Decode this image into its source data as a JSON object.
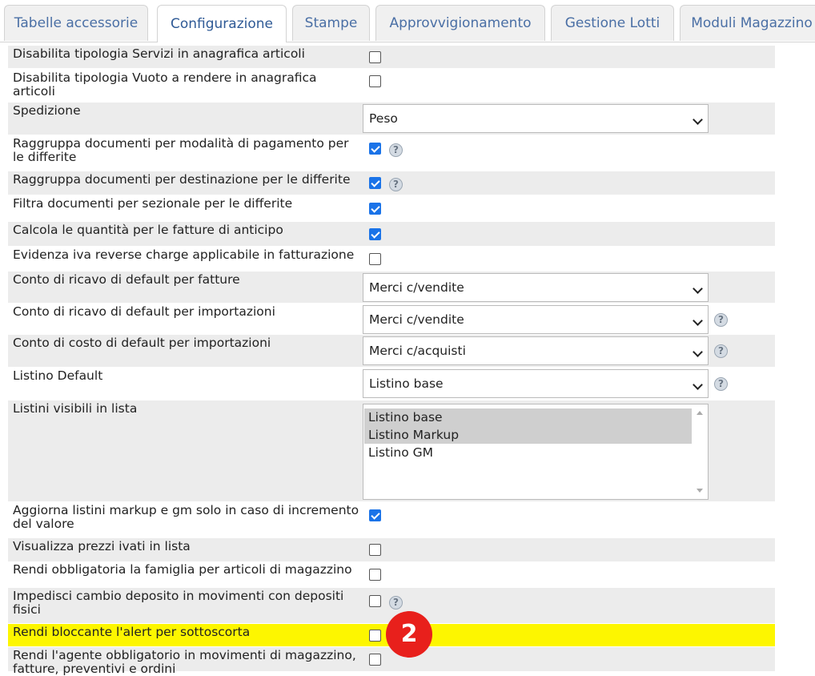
{
  "tabs": [
    {
      "label": "Tabelle accessorie",
      "active": false
    },
    {
      "label": "Configurazione",
      "active": true
    },
    {
      "label": "Stampe",
      "active": false
    },
    {
      "label": "Approvvigionamento",
      "active": false
    },
    {
      "label": "Gestione Lotti",
      "active": false
    },
    {
      "label": "Moduli Magazzino",
      "active": false
    }
  ],
  "settings": [
    {
      "label": "Disabilita tipologia Servizi in anagrafica articoli",
      "type": "checkbox",
      "checked": false,
      "help": false
    },
    {
      "label": "Disabilita tipologia Vuoto a rendere in anagrafica articoli",
      "type": "checkbox",
      "checked": false,
      "help": false
    },
    {
      "label": "Spedizione",
      "type": "select",
      "value": "Peso",
      "help": false
    },
    {
      "label": "Raggruppa documenti per modalità di pagamento per le differite",
      "type": "checkbox",
      "checked": true,
      "help": true
    },
    {
      "label": "Raggruppa documenti per destinazione per le differite",
      "type": "checkbox",
      "checked": true,
      "help": true
    },
    {
      "label": "Filtra documenti per sezionale per le differite",
      "type": "checkbox",
      "checked": true,
      "help": false
    },
    {
      "label": "Calcola le quantità per le fatture di anticipo",
      "type": "checkbox",
      "checked": true,
      "help": false
    },
    {
      "label": "Evidenza iva reverse charge applicabile in fatturazione",
      "type": "checkbox",
      "checked": false,
      "help": false
    },
    {
      "label": "Conto di ricavo di default per fatture",
      "type": "select",
      "value": "Merci c/vendite",
      "help": false
    },
    {
      "label": "Conto di ricavo di default per importazioni",
      "type": "select",
      "value": "Merci c/vendite",
      "help": true
    },
    {
      "label": "Conto di costo di default per importazioni",
      "type": "select",
      "value": "Merci c/acquisti",
      "help": true
    },
    {
      "label": "Listino Default",
      "type": "select",
      "value": "Listino base",
      "help": true
    },
    {
      "label": "Listini visibili in lista",
      "type": "multiselect",
      "options": [
        {
          "label": "Listino base",
          "selected": true
        },
        {
          "label": "Listino Markup",
          "selected": true
        },
        {
          "label": "Listino GM",
          "selected": false
        }
      ],
      "help": false
    },
    {
      "label": "Aggiorna listini markup e gm solo in caso di incremento del valore",
      "type": "checkbox",
      "checked": true,
      "help": false
    },
    {
      "label": "Visualizza prezzi ivati in lista",
      "type": "checkbox",
      "checked": false,
      "help": false
    },
    {
      "label": "Rendi obbligatoria la famiglia per articoli di magazzino",
      "type": "checkbox",
      "checked": false,
      "help": false
    },
    {
      "label": "Impedisci cambio deposito in movimenti con depositi fisici",
      "type": "checkbox",
      "checked": false,
      "help": true
    },
    {
      "label": "Rendi bloccante l'alert per sottoscorta",
      "type": "checkbox",
      "checked": false,
      "help": false,
      "highlighted": true
    },
    {
      "label": "Rendi l'agente obbligatorio in movimenti di magazzino, fatture, preventivi e ordini",
      "type": "checkbox",
      "checked": false,
      "help": false
    }
  ],
  "help_symbol": "?",
  "callout_marker": "2",
  "colors": {
    "accent": "#1a73e8",
    "highlight": "#fdf600",
    "marker": "#e8201c",
    "tab_text": "#4a6fa5"
  }
}
